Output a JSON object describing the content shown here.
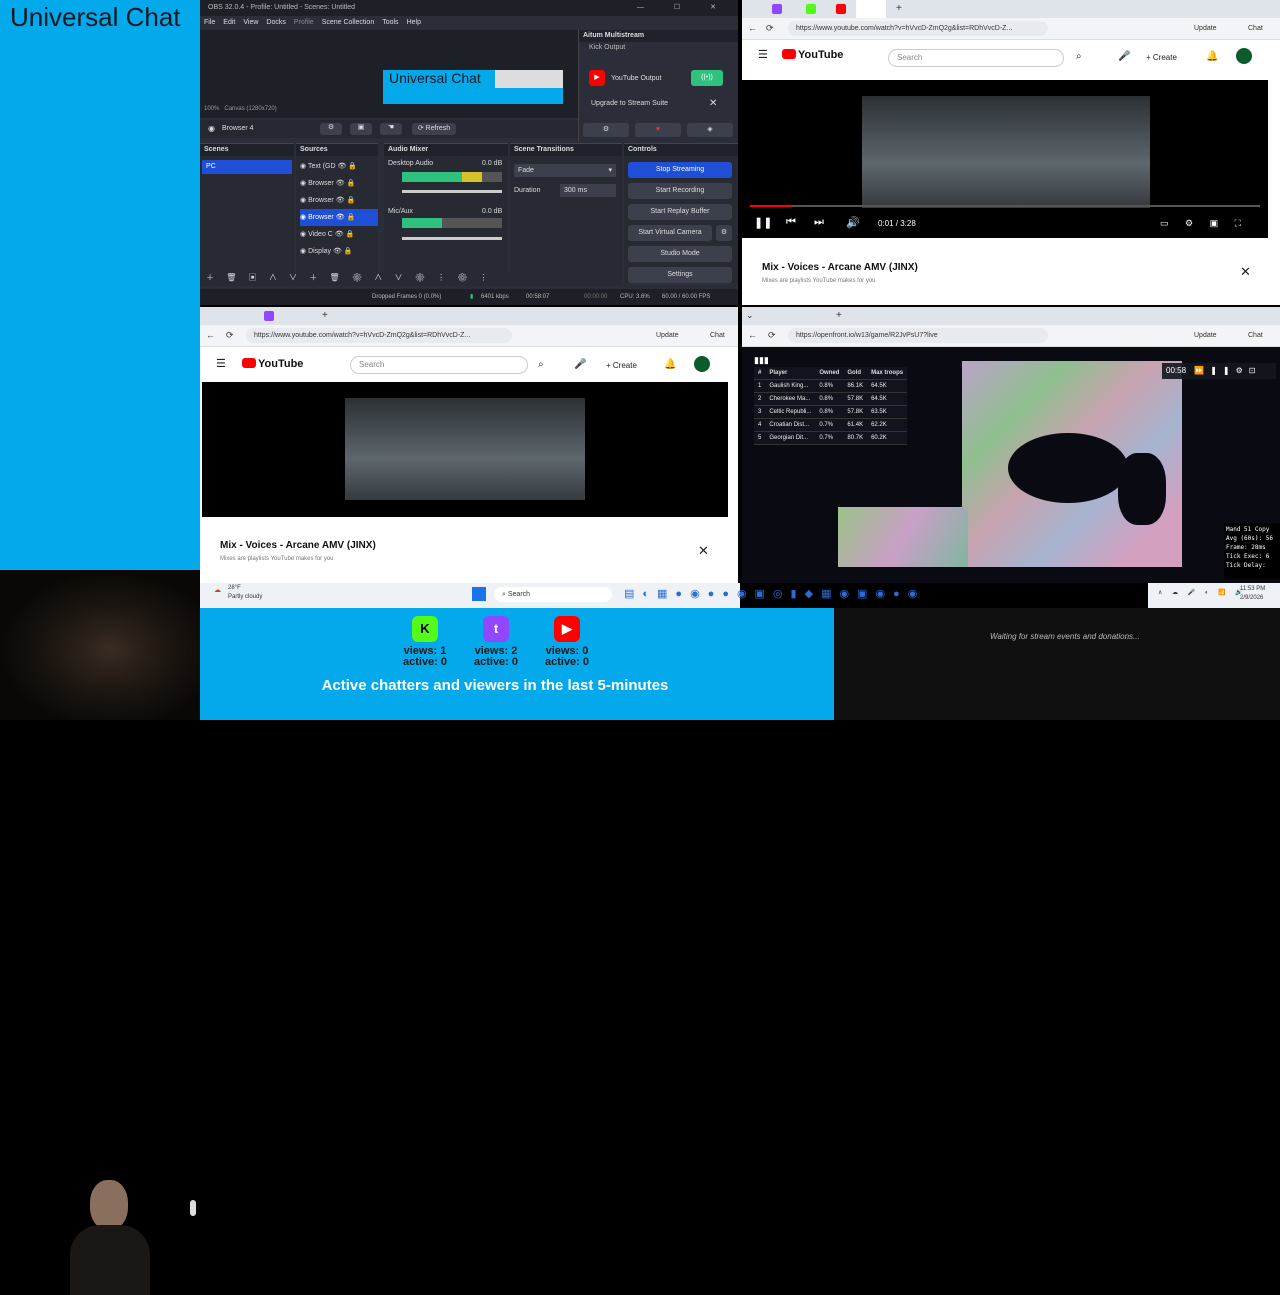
{
  "sidebar_title": "Universal Chat",
  "obs": {
    "window_title": "OBS 32.0.4 - Profile: Untitled - Scenes: Untitled",
    "menu": [
      "File",
      "Edit",
      "View",
      "Docks",
      "Profile",
      "Scene Collection",
      "Tools",
      "Help"
    ],
    "preview_title": "Universal Chat",
    "zoom": "100%",
    "canvas": "Canvas (1280x720)",
    "selected_source": "Browser 4",
    "refresh": "Refresh",
    "multistream_title": "Aitum Multistream",
    "kick_output": "Kick Output",
    "youtube_output": "YouTube Output",
    "upgrade": "Upgrade to Stream Suite",
    "docks": {
      "scenes": "Scenes",
      "sources": "Sources",
      "audio": "Audio Mixer",
      "transitions": "Scene Transitions",
      "controls": "Controls"
    },
    "scene": "PC",
    "sources": [
      "Text (GD",
      "Browser",
      "Browser",
      "Browser",
      "Video C",
      "Display"
    ],
    "audio": [
      {
        "name": "Desktop Audio",
        "db": "0.0 dB"
      },
      {
        "name": "Mic/Aux",
        "db": "0.0 dB"
      }
    ],
    "transition": "Fade",
    "duration_label": "Duration",
    "duration": "300 ms",
    "controls": [
      "Stop Streaming",
      "Start Recording",
      "Start Replay Buffer",
      "Start Virtual Camera",
      "Studio Mode",
      "Settings"
    ],
    "status": {
      "dropped": "Dropped Frames 0 (0.0%)",
      "kbps": "6401 kbps",
      "live": "00:58:07",
      "rec": "00:00:00",
      "cpu": "CPU: 3.6%",
      "fps": "60.00 / 60.00 FPS"
    }
  },
  "yt_top": {
    "url": "https://www.youtube.com/watch?v=hVvcD-ZmQ2g&list=RDhVvcD-Z...",
    "search": "Search",
    "create": "Create",
    "update": "Update",
    "chat": "Chat",
    "time": "0:01 / 3:28",
    "mix_title": "Mix - Voices - Arcane AMV (JINX)",
    "mix_sub": "Mixes are playlists YouTube makes for you",
    "progress": 0.01
  },
  "yt_bottom": {
    "url": "https://www.youtube.com/watch?v=hVvcD-ZmQ2g&list=RDhVvcD-Z...",
    "search": "Search",
    "create": "Create",
    "update": "Update",
    "chat": "Chat",
    "mix_title": "Mix - Voices - Arcane AMV (JINX)",
    "mix_sub": "Mixes are playlists YouTube makes for you"
  },
  "game": {
    "url": "https://openfront.io/w13/game/R2JvPsU7?live",
    "update": "Update",
    "chat": "Chat",
    "timer": "00:58",
    "headers": [
      "#",
      "Player",
      "Owned",
      "Gold",
      "Max troops"
    ],
    "rows": [
      [
        "1",
        "Gaulish King...",
        "0.8%",
        "86.1K",
        "64.5K"
      ],
      [
        "2",
        "Cherokee Ma...",
        "0.8%",
        "57.8K",
        "64.5K"
      ],
      [
        "3",
        "Celtic Republi...",
        "0.8%",
        "57.8K",
        "63.5K"
      ],
      [
        "4",
        "Croatian Dist...",
        "0.7%",
        "61.4K",
        "62.2K"
      ],
      [
        "5",
        "Georgian Dit...",
        "0.7%",
        "80.7K",
        "60.2K"
      ]
    ],
    "debug": [
      "Mand  51  Copy",
      "Avg (60s): 56",
      "Frame:  28ms",
      "Tick Exec: 6",
      "Tick Delay:"
    ]
  },
  "taskbar": {
    "weather_temp": "28°F",
    "weather": "Partly cloudy",
    "search": "Search",
    "time": "11:53 PM",
    "date": "2/9/2026"
  },
  "stats": [
    {
      "platform": "kick",
      "color": "#53fc18",
      "views": "views: 1",
      "active": "active: 0"
    },
    {
      "platform": "twitch",
      "color": "#9146ff",
      "views": "views: 2",
      "active": "active: 0"
    },
    {
      "platform": "youtube",
      "color": "#ff0000",
      "views": "views: 0",
      "active": "active: 0"
    }
  ],
  "stats_title": "Active chatters and viewers in the last 5-minutes",
  "events": "Waiting for stream events and donations..."
}
